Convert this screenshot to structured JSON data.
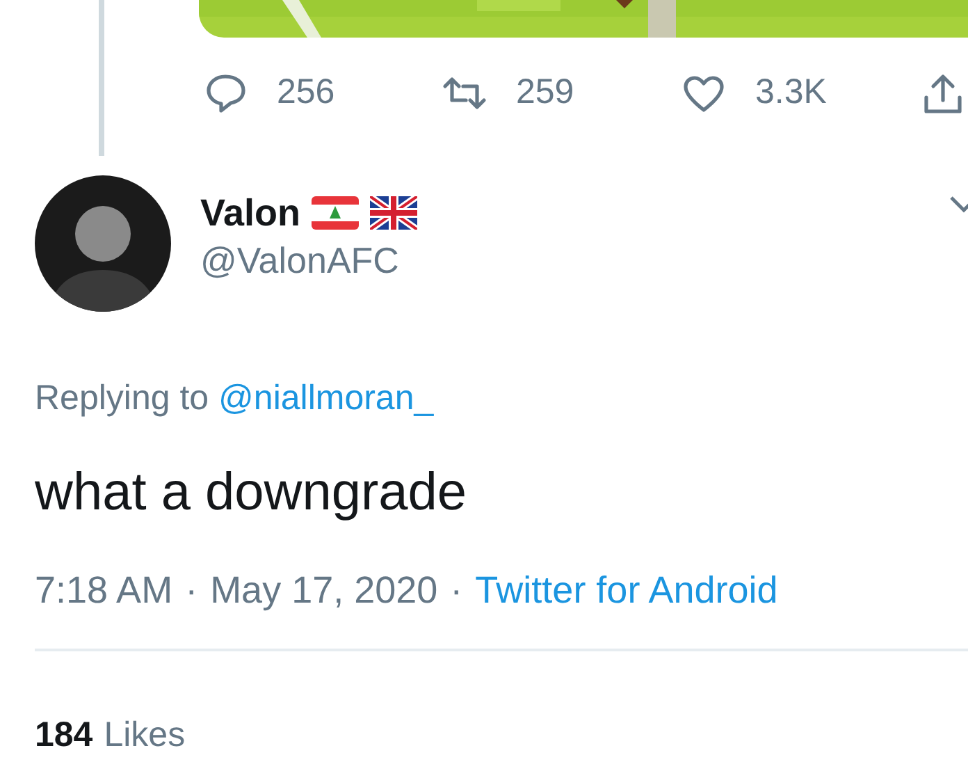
{
  "stats": [
    {
      "kind": "reply",
      "count": "256"
    },
    {
      "kind": "retweet",
      "count": "259"
    },
    {
      "kind": "like",
      "count": "3.3K"
    },
    {
      "kind": "share"
    }
  ],
  "author": {
    "name": "Valon",
    "handle": "@ValonAFC"
  },
  "reply_to": {
    "prefix": "Replying to",
    "handle": "@niallmoran_"
  },
  "text": "what a downgrade",
  "meta": [
    {
      "kind": "text",
      "text": "7:18 AM"
    },
    {
      "kind": "sep",
      "text": "·"
    },
    {
      "kind": "text",
      "text": "May 17, 2020"
    },
    {
      "kind": "sep",
      "text": "·"
    },
    {
      "kind": "link",
      "text": "Twitter for Android"
    }
  ],
  "likes": {
    "count": "184",
    "label": "Likes"
  }
}
